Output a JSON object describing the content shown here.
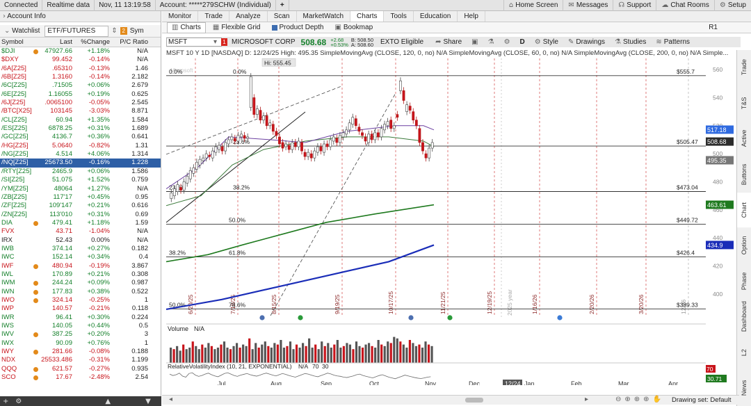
{
  "topbar": {
    "status": "Connected",
    "data_mode": "Realtime data",
    "datetime": "Nov, 11  13:19:58",
    "account": "Account: *****279SCHW (Individual)",
    "plus": "+",
    "buttons": [
      "Home Screen",
      "Messages",
      "Support",
      "Chat Rooms",
      "Setup"
    ],
    "ondemand": "OnDemand"
  },
  "left": {
    "account_info": "Account Info",
    "tab_watchlist": "Watchlist",
    "etf_select": "ETF/FUTURES",
    "sym_label": "Sym",
    "columns": [
      "Symbol",
      "Last",
      "%Change",
      "P/C Ratio"
    ],
    "rows": [
      [
        "$DJI",
        "47927.66",
        "+1.18%",
        "N/A",
        0
      ],
      [
        "$DXY",
        "99.452",
        "-0.14%",
        "N/A",
        0
      ],
      [
        "/6A[Z25]",
        ".65310",
        "-0.13%",
        "1.46",
        0
      ],
      [
        "/6B[Z25]",
        "1.3160",
        "-0.14%",
        "2.182",
        0
      ],
      [
        "/6C[Z25]",
        ".71505",
        "+0.06%",
        "2.679",
        0
      ],
      [
        "/6E[Z25]",
        "1.16055",
        "+0.19%",
        "0.625",
        0
      ],
      [
        "/6J[Z25]",
        ".0065100",
        "-0.05%",
        "2.545",
        0
      ],
      [
        "/BTC[X25]",
        "103145",
        "-3.03%",
        "8.871",
        0
      ],
      [
        "/CL[Z25]",
        "60.94",
        "+1.35%",
        "1.584",
        0
      ],
      [
        "/ES[Z25]",
        "6878.25",
        "+0.31%",
        "1.689",
        0
      ],
      [
        "/GC[Z25]",
        "4136.7",
        "+0.36%",
        "0.641",
        0
      ],
      [
        "/HG[Z25]",
        "5.0640",
        "-0.82%",
        "1.31",
        0
      ],
      [
        "/NG[Z25]",
        "4.514",
        "+4.06%",
        "1.314",
        0
      ],
      [
        "/NQ[Z25]",
        "25673.50",
        "-0.16%",
        "1.228",
        1
      ],
      [
        "/RTY[Z25]",
        "2465.9",
        "+0.06%",
        "1.586",
        0
      ],
      [
        "/SI[Z25]",
        "51.075",
        "+1.52%",
        "0.759",
        0
      ],
      [
        "/YM[Z25]",
        "48064",
        "+1.27%",
        "N/A",
        0
      ],
      [
        "/ZB[Z25]",
        "117'17",
        "+0.45%",
        "0.95",
        0
      ],
      [
        "/ZF[Z25]",
        "109'147",
        "+0.21%",
        "0.616",
        0
      ],
      [
        "/ZN[Z25]",
        "113'010",
        "+0.31%",
        "0.69",
        0
      ],
      [
        "DIA",
        "479.41",
        "+1.18%",
        "1.59",
        0
      ],
      [
        "FVX",
        "43.71",
        "-1.04%",
        "N/A",
        0
      ],
      [
        "IRX",
        "52.43",
        "0.00%",
        "N/A",
        0
      ],
      [
        "IWB",
        "374.14",
        "+0.27%",
        "0.182",
        0
      ],
      [
        "IWC",
        "152.14",
        "+0.34%",
        "0.4",
        0
      ],
      [
        "IWF",
        "480.94",
        "-0.19%",
        "3.867",
        0
      ],
      [
        "IWL",
        "170.89",
        "+0.21%",
        "0.308",
        0
      ],
      [
        "IWM",
        "244.24",
        "+0.09%",
        "0.987",
        0
      ],
      [
        "IWN",
        "177.83",
        "+0.38%",
        "0.522",
        0
      ],
      [
        "IWO",
        "324.14",
        "-0.25%",
        "1",
        0
      ],
      [
        "IWP",
        "140.57",
        "-0.21%",
        "0.118",
        0
      ],
      [
        "IWR",
        "96.41",
        "+0.30%",
        "0.224",
        0
      ],
      [
        "IWS",
        "140.05",
        "+0.44%",
        "0.5",
        0
      ],
      [
        "IWV",
        "387.25",
        "+0.20%",
        "3",
        0
      ],
      [
        "IWX",
        "90.09",
        "+0.76%",
        "1",
        0
      ],
      [
        "IWY",
        "281.66",
        "-0.08%",
        "0.188",
        0
      ],
      [
        "NDX",
        "25533.486",
        "-0.31%",
        "1.199",
        0
      ],
      [
        "QQQ",
        "621.57",
        "-0.27%",
        "0.935",
        0
      ],
      [
        "SCO",
        "17.67",
        "-2.48%",
        "2.54",
        0
      ]
    ],
    "dots": [
      0,
      20,
      25,
      27,
      28,
      29,
      33,
      35,
      37,
      38
    ]
  },
  "menu": {
    "items": [
      "Monitor",
      "Trade",
      "Analyze",
      "Scan",
      "MarketWatch",
      "Charts",
      "Tools",
      "Education",
      "Help"
    ],
    "active": 5
  },
  "subbar": {
    "items": [
      "Charts",
      "Flexible Grid",
      "Product Depth",
      "Bookmap"
    ],
    "r1": "R1"
  },
  "toolbar": {
    "symbol": "MSFT",
    "badge": "1",
    "company": "MICROSOFT CORP",
    "price": "508.68",
    "chg": "+2.68",
    "chg_pct": "+0.53%",
    "bid": "B: 508.50",
    "ask": "A: 508.60",
    "exto": "EXTO Eligible",
    "buttons": [
      "Share",
      "D",
      "Style",
      "Drawings",
      "Studies",
      "Patterns"
    ]
  },
  "studybar": {
    "text": "MSFT 10 Y 1D [NASDAQ]  D: 12/24/25  High: 495.35  SimpleMovingAvg (CLOSE, 120, 0, no)  N/A  SimpleMovingAvg (CLOSE, 60, 0, no)  N/A  SimpleMovingAvg (CLOSE, 200, 0, no)  N/A  Simple..."
  },
  "chart": {
    "hi_label": "Hi: 555.45",
    "watermark": "Microsoft",
    "price_ticks": [
      "560",
      "540",
      "520",
      "500",
      "480",
      "460",
      "440",
      "420",
      "400"
    ],
    "price_tags": [
      {
        "v": "555.7",
        "bg": "#fff",
        "fg": "#111",
        "p": 555.7
      },
      {
        "v": "517.18",
        "bg": "#2f6ae0",
        "fg": "#fff",
        "p": 517.18
      },
      {
        "v": "508.68",
        "bg": "#2c2c2c",
        "fg": "#fff",
        "p": 508.68
      },
      {
        "v": "495.35",
        "bg": "#777",
        "fg": "#fff",
        "p": 495.35
      },
      {
        "v": "463.61",
        "bg": "#1f7a1f",
        "fg": "#fff",
        "p": 463.61
      },
      {
        "v": "434.9",
        "bg": "#1a2db8",
        "fg": "#fff",
        "p": 434.9
      }
    ],
    "fib_labels": [
      {
        "p": 555.7,
        "l": "0.0%",
        "r": "$555.7",
        "lx": "0.0%"
      },
      {
        "p": 505.47,
        "l": "23.6%",
        "r": "$505.47"
      },
      {
        "p": 473.04,
        "l": "38.2%",
        "r": "$473.04",
        "l2": "23.6%"
      },
      {
        "p": 449.72,
        "l": "50.0%",
        "r": "$449.72"
      },
      {
        "p": 426.4,
        "l": "61.8%",
        "r": "$426.4",
        "l2": "38.2%"
      },
      {
        "p": 389.33,
        "l": "78.6%",
        "r": "$389.33",
        "l2": "50.0%"
      }
    ],
    "date_lines": [
      "6/20/25",
      "7/18/25",
      "8/15/25",
      "9/19/25",
      "10/17/25",
      "11/21/25",
      "12/19/25",
      "1/16/26",
      "2/20/26",
      "3/20/26",
      "12/26"
    ],
    "year_label": "2025 year",
    "months": [
      "Jul",
      "Aug",
      "Sep",
      "Oct",
      "Nov",
      "Dec",
      "Jan",
      "Feb",
      "Mar",
      "Apr"
    ],
    "cursor_date": "12/24",
    "volume_label": "Volume",
    "volume_na": "N/A",
    "rvi_label": "RelativeVolatilityIndex (10, 21, EXPONENTIAL)",
    "rvi_na": "N/A",
    "rvi_70": "70",
    "rvi_30": "30",
    "rvi_tags": [
      "70",
      "30.71"
    ],
    "drawing_set": "Drawing set: Default",
    "side_tabs": [
      "Trade",
      "T&S",
      "Active Trader",
      "Buttons",
      "Chart",
      "Option Chain",
      "Phase Scores",
      "Dashboard",
      "L2",
      "News"
    ],
    "side_active": 4
  },
  "colors": {
    "up": "#15802b",
    "down": "#c8141b",
    "selected": "#2e5fa6",
    "sma120": "#1a2db8",
    "sma60": "#1f7a1f",
    "sma200": "#6b3fa0"
  }
}
